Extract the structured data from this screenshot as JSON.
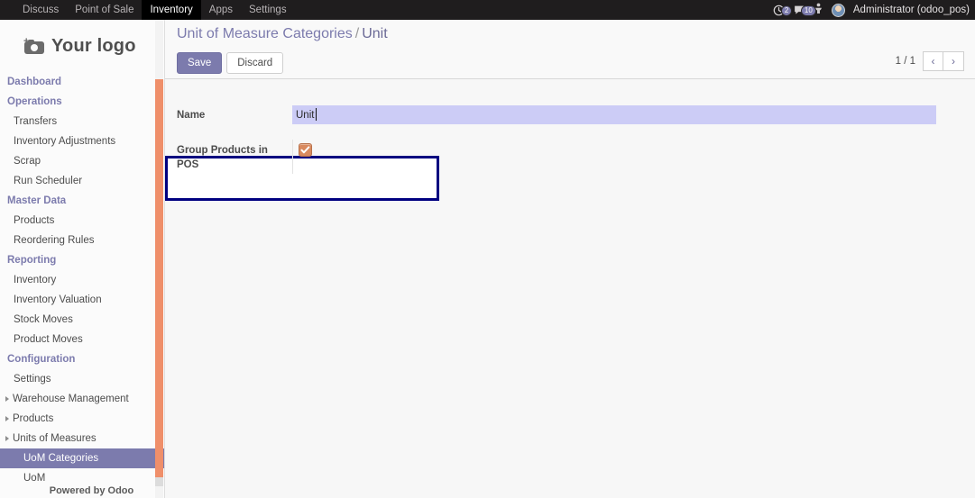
{
  "navbar": {
    "menus": [
      {
        "label": "Discuss",
        "active": false
      },
      {
        "label": "Point of Sale",
        "active": false
      },
      {
        "label": "Inventory",
        "active": true
      },
      {
        "label": "Apps",
        "active": false
      },
      {
        "label": "Settings",
        "active": false
      }
    ],
    "activities_count": "2",
    "messages_count": "10",
    "user_name": "Administrator (odoo_pos)",
    "accent_color": "#7c7bad"
  },
  "sidebar": {
    "logo_text": "Your logo",
    "footer": "Powered by Odoo",
    "scrollbar_color": "#ef8f6a",
    "entries": [
      {
        "type": "section",
        "label": "Dashboard"
      },
      {
        "type": "section",
        "label": "Operations"
      },
      {
        "type": "item",
        "label": "Transfers"
      },
      {
        "type": "item",
        "label": "Inventory Adjustments"
      },
      {
        "type": "item",
        "label": "Scrap"
      },
      {
        "type": "item",
        "label": "Run Scheduler"
      },
      {
        "type": "section",
        "label": "Master Data"
      },
      {
        "type": "item",
        "label": "Products"
      },
      {
        "type": "item",
        "label": "Reordering Rules"
      },
      {
        "type": "section",
        "label": "Reporting"
      },
      {
        "type": "item",
        "label": "Inventory"
      },
      {
        "type": "item",
        "label": "Inventory Valuation"
      },
      {
        "type": "item",
        "label": "Stock Moves"
      },
      {
        "type": "item",
        "label": "Product Moves"
      },
      {
        "type": "section",
        "label": "Configuration"
      },
      {
        "type": "item",
        "label": "Settings"
      },
      {
        "type": "toggle",
        "label": "Warehouse Management"
      },
      {
        "type": "toggle",
        "label": "Products"
      },
      {
        "type": "toggle",
        "label": "Units of Measures"
      },
      {
        "type": "active",
        "label": "UoM Categories"
      },
      {
        "type": "sub",
        "label": "UoM"
      }
    ]
  },
  "control_panel": {
    "breadcrumb_root": "Unit of Measure Categories",
    "breadcrumb_separator": "/",
    "breadcrumb_current": "Unit",
    "save_label": "Save",
    "discard_label": "Discard",
    "pager_value": "1 / 1",
    "pager_prev": "‹",
    "pager_next": "›"
  },
  "form": {
    "name_label": "Name",
    "name_value": "Unit",
    "name_placeholder": "",
    "pos_label": "Group Products in POS",
    "pos_checked": true,
    "highlight_color": "#000080",
    "focused_field_bg": "#ccccf6",
    "checkbox_color": "#d98a5f"
  }
}
